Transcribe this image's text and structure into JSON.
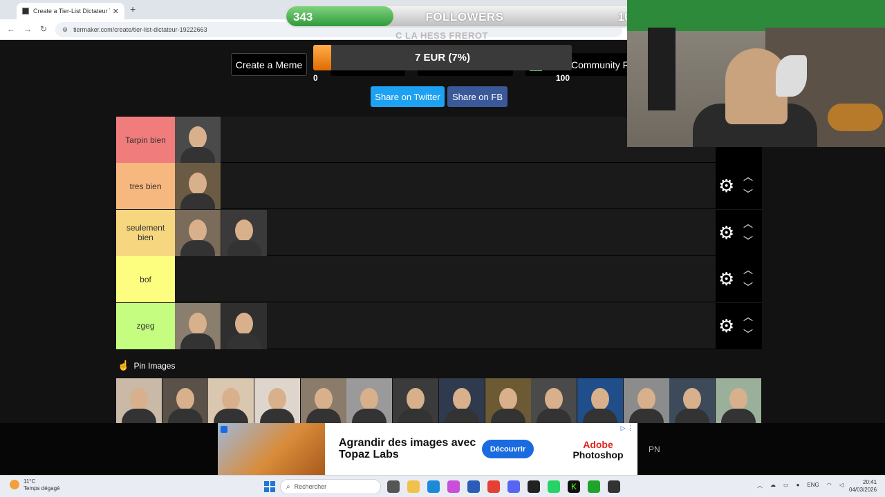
{
  "browser": {
    "tab_title": "Create a Tier-List Dictateur Tier",
    "url": "tiermaker.com/create/tier-list-dictateur-19222663"
  },
  "overlay": {
    "followers_count": "343",
    "followers_label": "FOLLOWERS",
    "followers_goal": "100",
    "followers_progress": 0.3,
    "subtitle": "C LA HESS FREROT",
    "donation_text": "7 EUR (7%)",
    "donation_progress": 0.07,
    "donation_min": "0",
    "donation_max": "100"
  },
  "site": {
    "create_meme": "Create a Meme",
    "community": "Community Ra",
    "share_twitter": "Share on Twitter",
    "share_fb": "Share on FB",
    "pin_images": "Pin Images"
  },
  "tiers": [
    {
      "label": "Tarpin bien",
      "color": "#f07c7c",
      "images": [
        "hitler"
      ]
    },
    {
      "label": "tres bien",
      "color": "#f7b87f",
      "images": [
        "man-in-hat"
      ]
    },
    {
      "label": "seulement bien",
      "color": "#f6d77f",
      "images": [
        "castro",
        "cartoon-character"
      ]
    },
    {
      "label": "bof",
      "color": "#fdfd7f",
      "images": []
    },
    {
      "label": "zgeg",
      "color": "#c4fd7f",
      "images": [
        "man-with-glasses",
        "man-in-suit"
      ]
    }
  ],
  "gallery": [
    "brigitte",
    "man-gray-hair",
    "trump",
    "bald-man",
    "melenchon",
    "stalin",
    "kim",
    "macron",
    "gaddafi",
    "mussolini",
    "putin",
    "petain",
    "bardella",
    "woman-curly-hair"
  ],
  "ad": {
    "headline": "Agrandir des images avec Topaz Labs",
    "cta": "Découvrir",
    "brand_1": "Adobe",
    "brand_2": "Photoshop",
    "pn": "PN"
  },
  "taskbar": {
    "weather_temp": "11°C",
    "weather_desc": "Temps dégagé",
    "search": "Rechercher",
    "lang": "ENG",
    "time": "20:41",
    "date": "04/03/2026"
  }
}
